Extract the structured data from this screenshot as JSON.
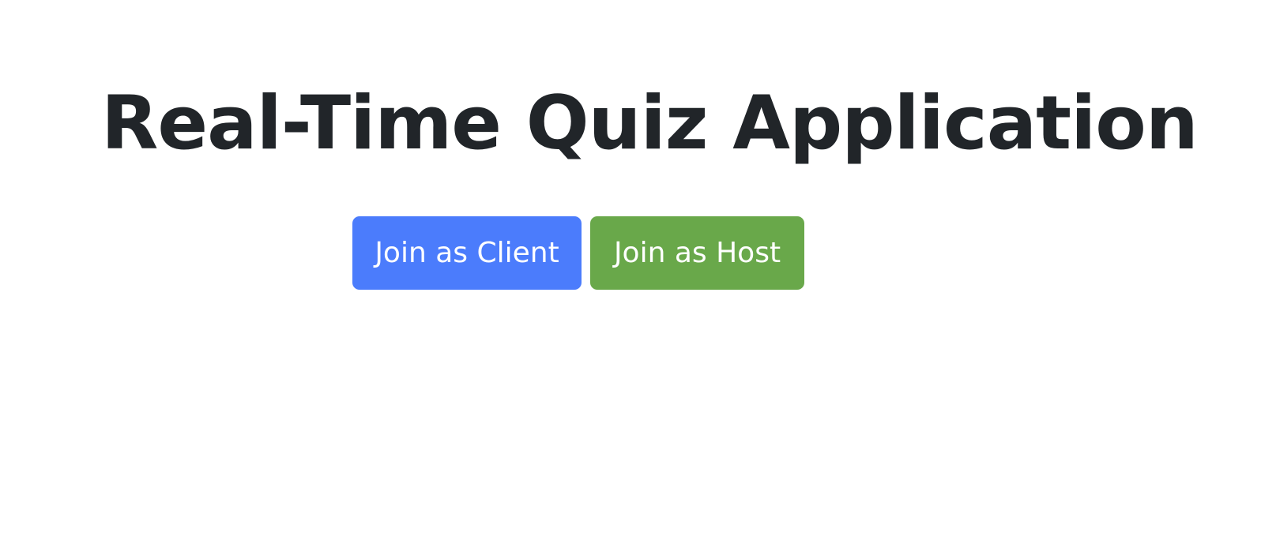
{
  "page": {
    "title": "Real-Time Quiz Application"
  },
  "actions": {
    "client_label": "Join as Client",
    "host_label": "Join as Host"
  },
  "colors": {
    "client_button": "#4b7cfc",
    "host_button": "#69a84a",
    "text": "#212529",
    "background": "#ffffff"
  }
}
